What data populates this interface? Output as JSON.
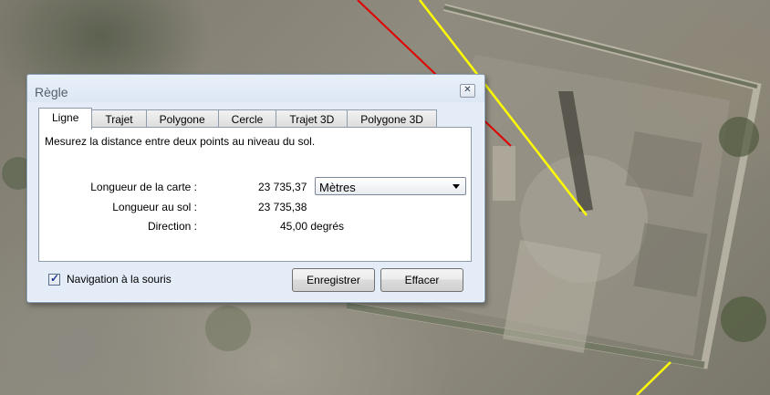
{
  "dialog": {
    "title": "Règle",
    "close_icon": "close-icon",
    "tabs": [
      {
        "label": "Ligne",
        "active": true
      },
      {
        "label": "Trajet",
        "active": false
      },
      {
        "label": "Polygone",
        "active": false
      },
      {
        "label": "Cercle",
        "active": false
      },
      {
        "label": "Trajet 3D",
        "active": false
      },
      {
        "label": "Polygone 3D",
        "active": false
      }
    ],
    "description": "Mesurez la distance entre deux points au niveau du sol.",
    "map_length": {
      "label": "Longueur de la carte :",
      "value": "23 735,37"
    },
    "unit_select": {
      "selected": "Mètres"
    },
    "ground_length": {
      "label": "Longueur au sol :",
      "value": "23 735,38"
    },
    "direction": {
      "label": "Direction :",
      "value": "45,00 degrés"
    },
    "mouse_nav": {
      "label": "Navigation à la souris",
      "checked": true
    },
    "save_button": "Enregistrer",
    "clear_button": "Effacer"
  },
  "colors": {
    "measure_line": "#ffff00",
    "path_line": "#e00000",
    "dialog_bg": "#e3ecf7"
  }
}
